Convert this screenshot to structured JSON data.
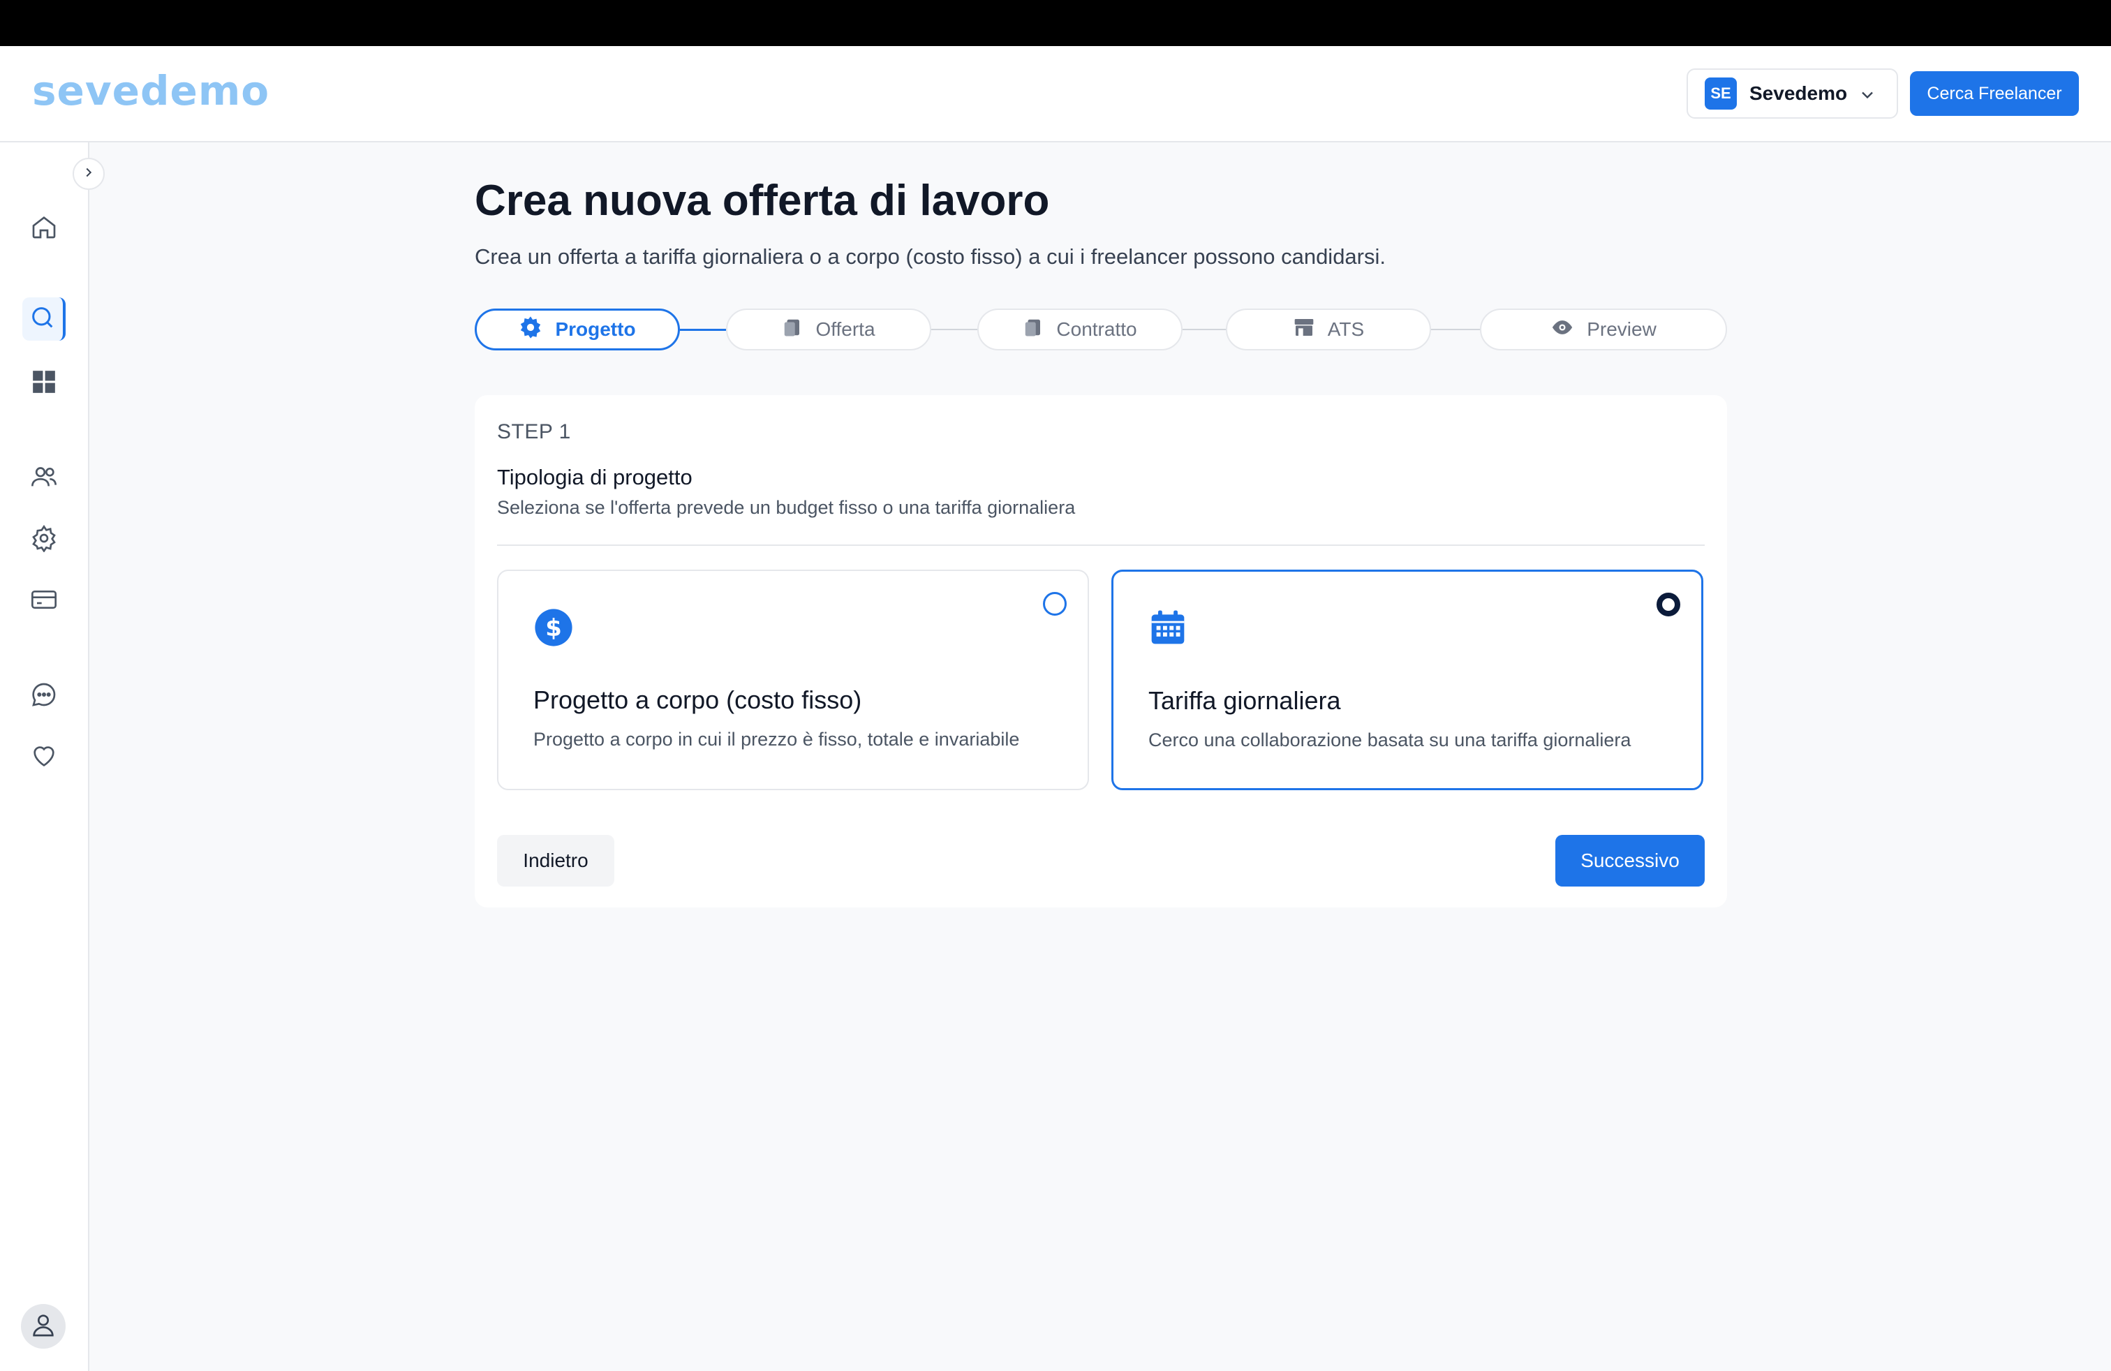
{
  "header": {
    "logo_text": "sevedemo",
    "account": {
      "badge": "SE",
      "name": "Sevedemo"
    },
    "cta_label": "Cerca Freelancer"
  },
  "sidebar": {
    "items": [
      {
        "name": "home",
        "icon": "home-icon"
      },
      {
        "name": "search",
        "icon": "search-icon",
        "active": true
      },
      {
        "name": "dashboard",
        "icon": "grid-icon"
      },
      {
        "name": "team",
        "icon": "users-icon"
      },
      {
        "name": "settings",
        "icon": "gear-icon"
      },
      {
        "name": "billing",
        "icon": "credit-card-icon"
      },
      {
        "name": "messages",
        "icon": "chat-icon"
      },
      {
        "name": "favorites",
        "icon": "heart-icon"
      }
    ]
  },
  "page": {
    "title": "Crea nuova offerta di lavoro",
    "subtitle": "Crea un offerta a tariffa giornaliera o a corpo (costo fisso) a cui i freelancer possono candidarsi."
  },
  "stepper": {
    "steps": [
      {
        "label": "Progetto",
        "icon": "gear-icon",
        "active": true
      },
      {
        "label": "Offerta",
        "icon": "document-icon"
      },
      {
        "label": "Contratto",
        "icon": "document-icon"
      },
      {
        "label": "ATS",
        "icon": "store-icon"
      },
      {
        "label": "Preview",
        "icon": "eye-icon"
      }
    ]
  },
  "form": {
    "step_label": "STEP 1",
    "section_title": "Tipologia di progetto",
    "section_desc": "Seleziona se l'offerta prevede un budget fisso o una tariffa giornaliera",
    "options": [
      {
        "title": "Progetto a corpo (costo fisso)",
        "desc": "Progetto a corpo in cui il prezzo è fisso, totale e invariabile",
        "icon": "dollar-icon",
        "selected": false
      },
      {
        "title": "Tariffa giornaliera",
        "desc": "Cerco una collaborazione basata su una tariffa giornaliera",
        "icon": "calendar-icon",
        "selected": true
      }
    ],
    "back_label": "Indietro",
    "next_label": "Successivo"
  },
  "colors": {
    "accent": "#1e74e8",
    "logo": "#8ec5f5"
  }
}
